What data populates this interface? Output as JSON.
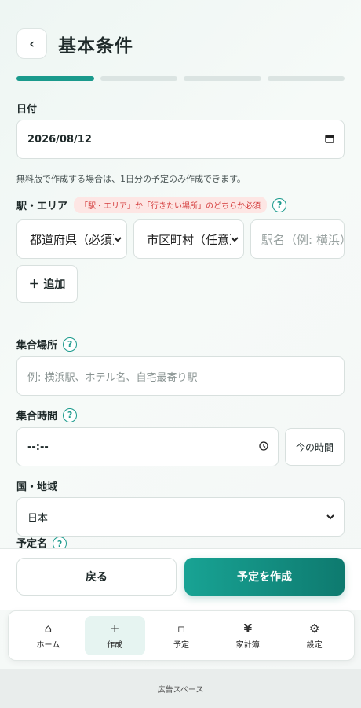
{
  "header": {
    "back_glyph": "‹",
    "title": "基本条件"
  },
  "progress": {
    "steps": 4,
    "current": 1
  },
  "date": {
    "label": "日付",
    "value": "2026/08/12",
    "icon": "calendar-icon"
  },
  "note": "無料版で作成する場合は、1日分の予定のみ作成できます。",
  "station": {
    "label": "駅・エリア",
    "badge": "「駅・エリア」か「行きたい場所」のどちらか必須",
    "help": "?",
    "prefecture_placeholder": "都道府県（必須）",
    "city_placeholder": "市区町村（任意）",
    "station_placeholder": "駅名（例: 横浜）",
    "add_label": "＋ 追加"
  },
  "meeting_place": {
    "label": "集合場所",
    "help": "?",
    "placeholder": "例: 横浜駅、ホテル名、自宅最寄り駅"
  },
  "meeting_time": {
    "label": "集合時間",
    "help": "?",
    "value": "--:--",
    "now_label": "今の時間"
  },
  "country": {
    "label": "国・地域",
    "value": "日本"
  },
  "plan_name": {
    "label": "予定名",
    "help": "?"
  },
  "actions": {
    "back_label": "戻る",
    "create_label": "予定を作成"
  },
  "tabs": [
    {
      "label": "ホーム",
      "icon": "⌂"
    },
    {
      "label": "作成",
      "icon": "+"
    },
    {
      "label": "予定",
      "icon": "▫"
    },
    {
      "label": "家計簿",
      "icon": "¥"
    },
    {
      "label": "設定",
      "icon": "⚙"
    }
  ],
  "ad_label": "広告スペース",
  "colors": {
    "accent": "#1a9a8c",
    "badge_text": "#d43c3c"
  }
}
